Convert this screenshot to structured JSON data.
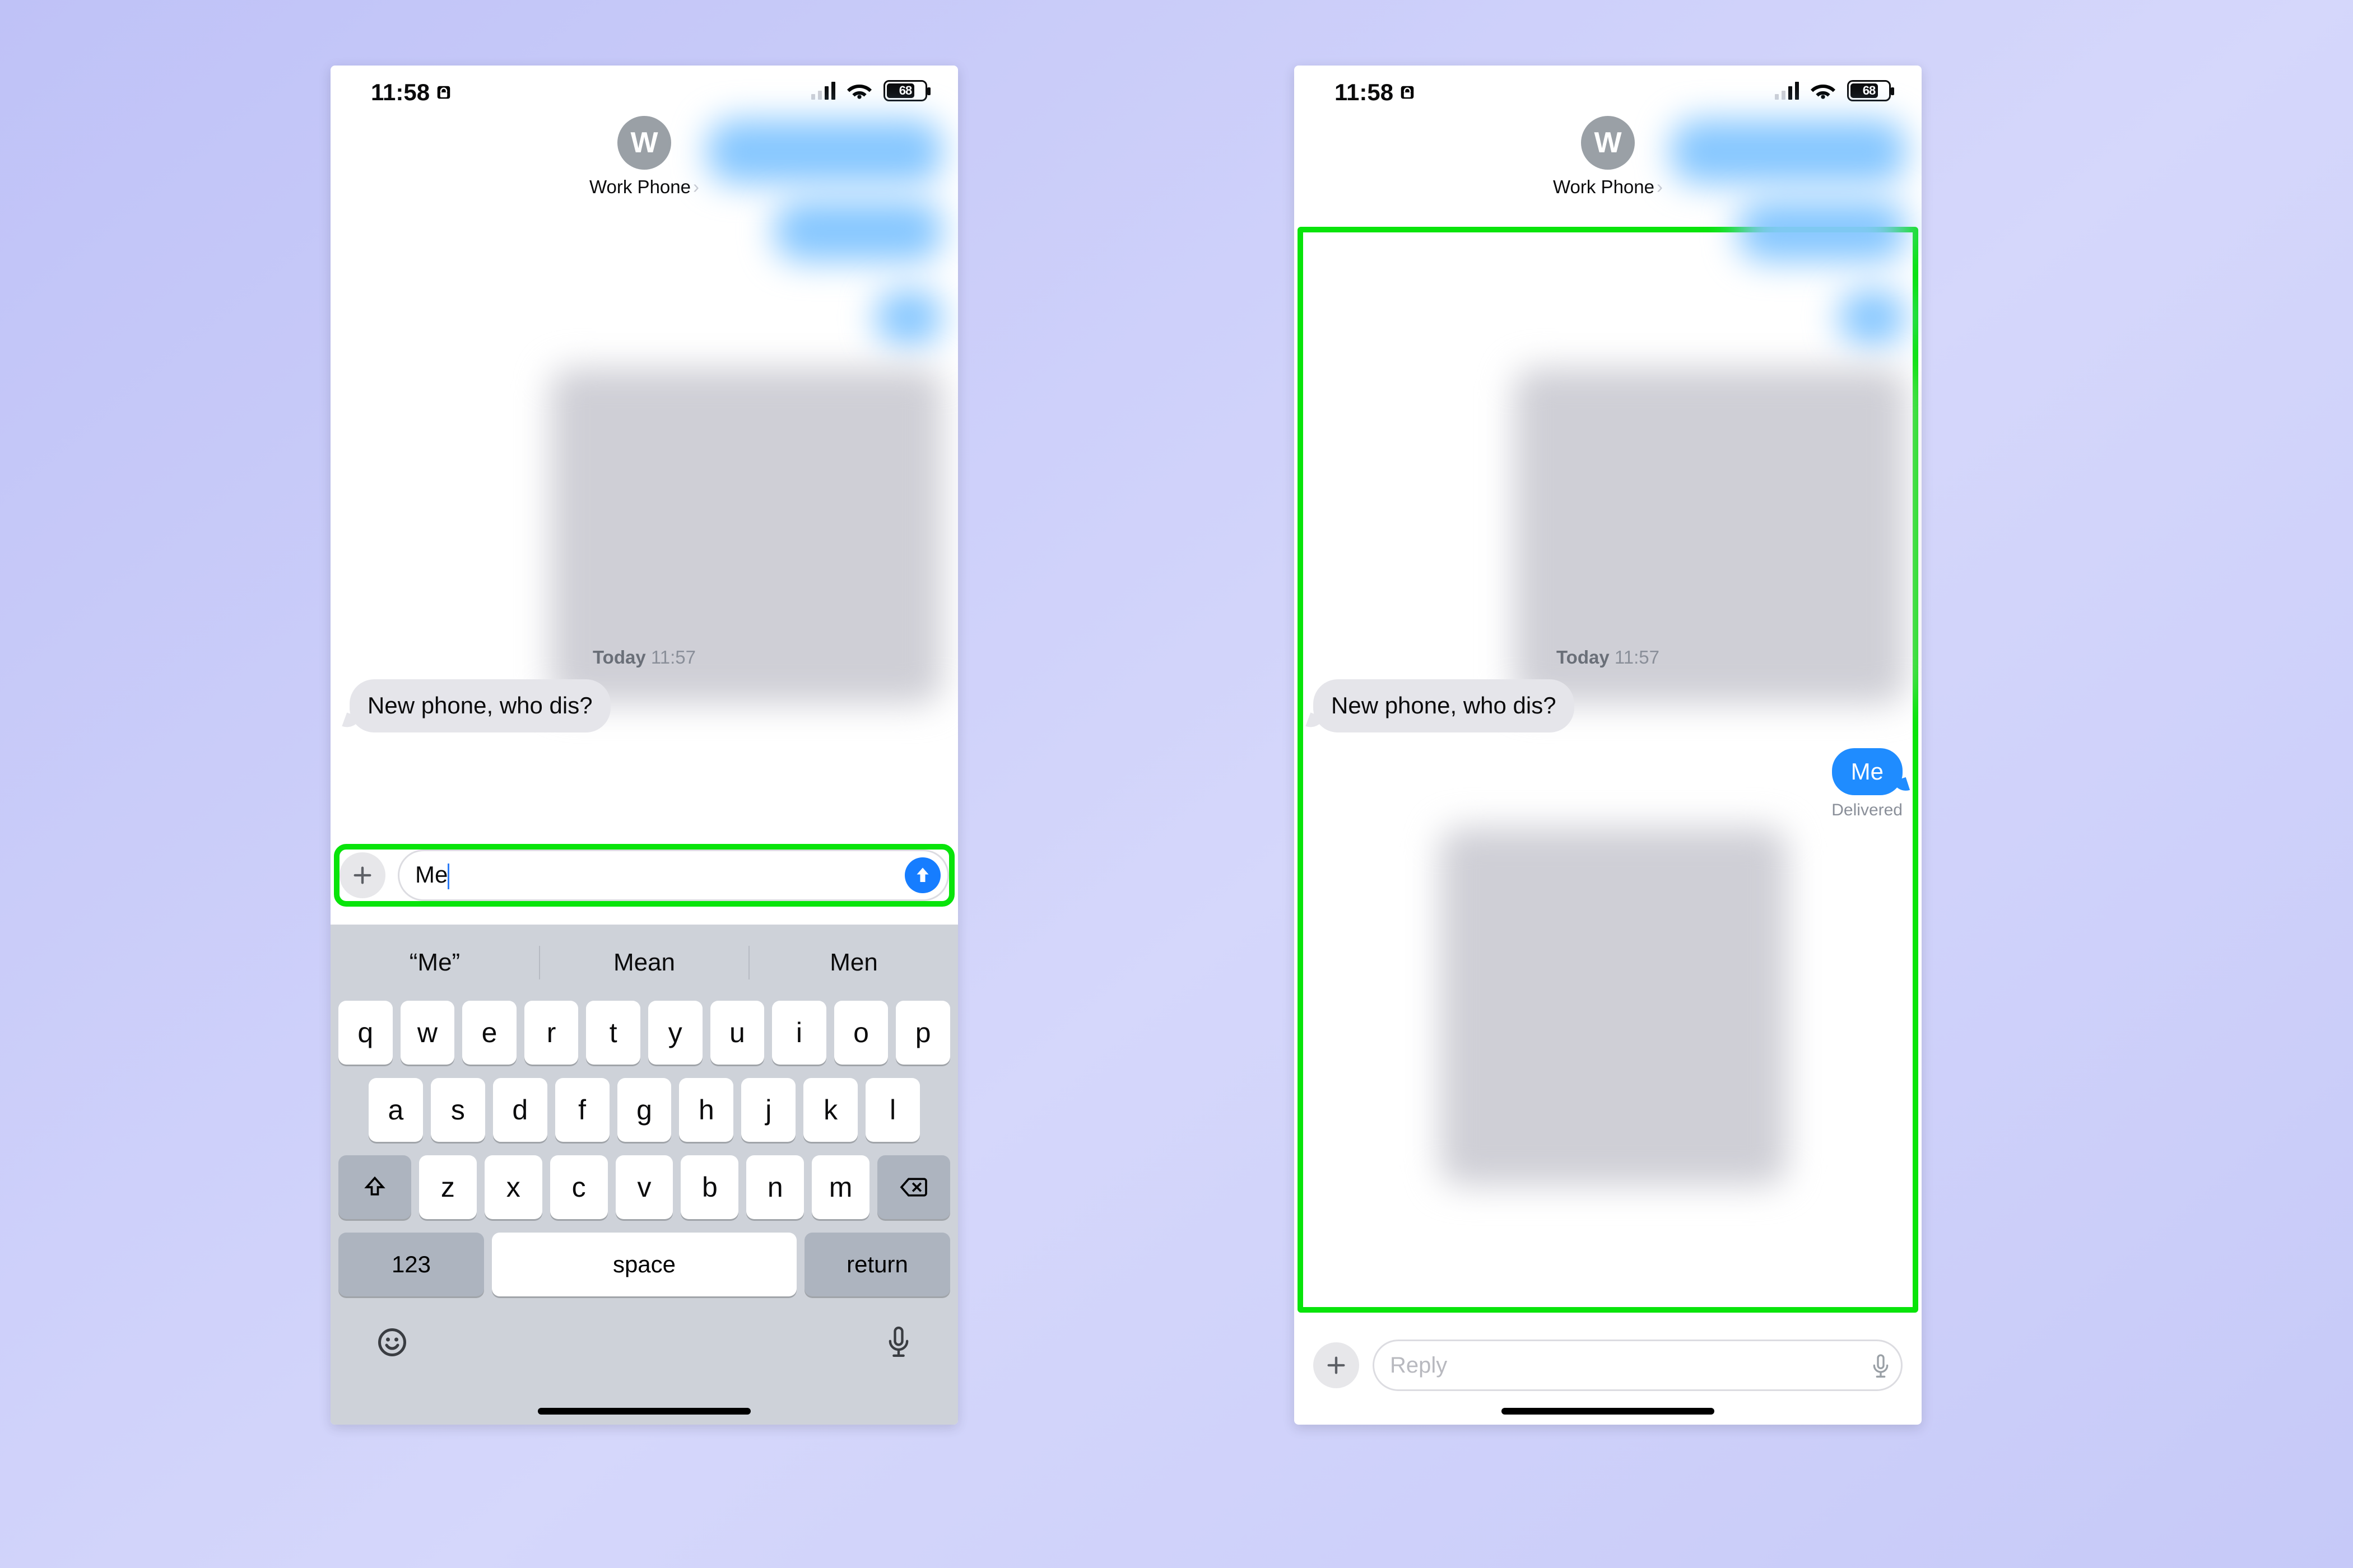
{
  "common": {
    "status_time": "11:58",
    "battery_pct": "68",
    "battery_fill_pct": 68
  },
  "left": {
    "avatar_initial": "W",
    "contact_name": "Work Phone",
    "timestamp_label": "Today",
    "timestamp_time": "11:57",
    "incoming_msg": "New phone, who dis?",
    "compose_value": "Me",
    "predictions": [
      "“Me”",
      "Mean",
      "Men"
    ],
    "keys_row1": [
      "q",
      "w",
      "e",
      "r",
      "t",
      "y",
      "u",
      "i",
      "o",
      "p"
    ],
    "keys_row2": [
      "a",
      "s",
      "d",
      "f",
      "g",
      "h",
      "j",
      "k",
      "l"
    ],
    "keys_row3": [
      "z",
      "x",
      "c",
      "v",
      "b",
      "n",
      "m"
    ],
    "key_123": "123",
    "key_space": "space",
    "key_return": "return"
  },
  "right": {
    "avatar_initial": "W",
    "contact_name": "Work Phone",
    "timestamp_label": "Today",
    "timestamp_time": "11:57",
    "incoming_msg": "New phone, who dis?",
    "outgoing_msg": "Me",
    "delivered_label": "Delivered",
    "reply_placeholder": "Reply"
  }
}
